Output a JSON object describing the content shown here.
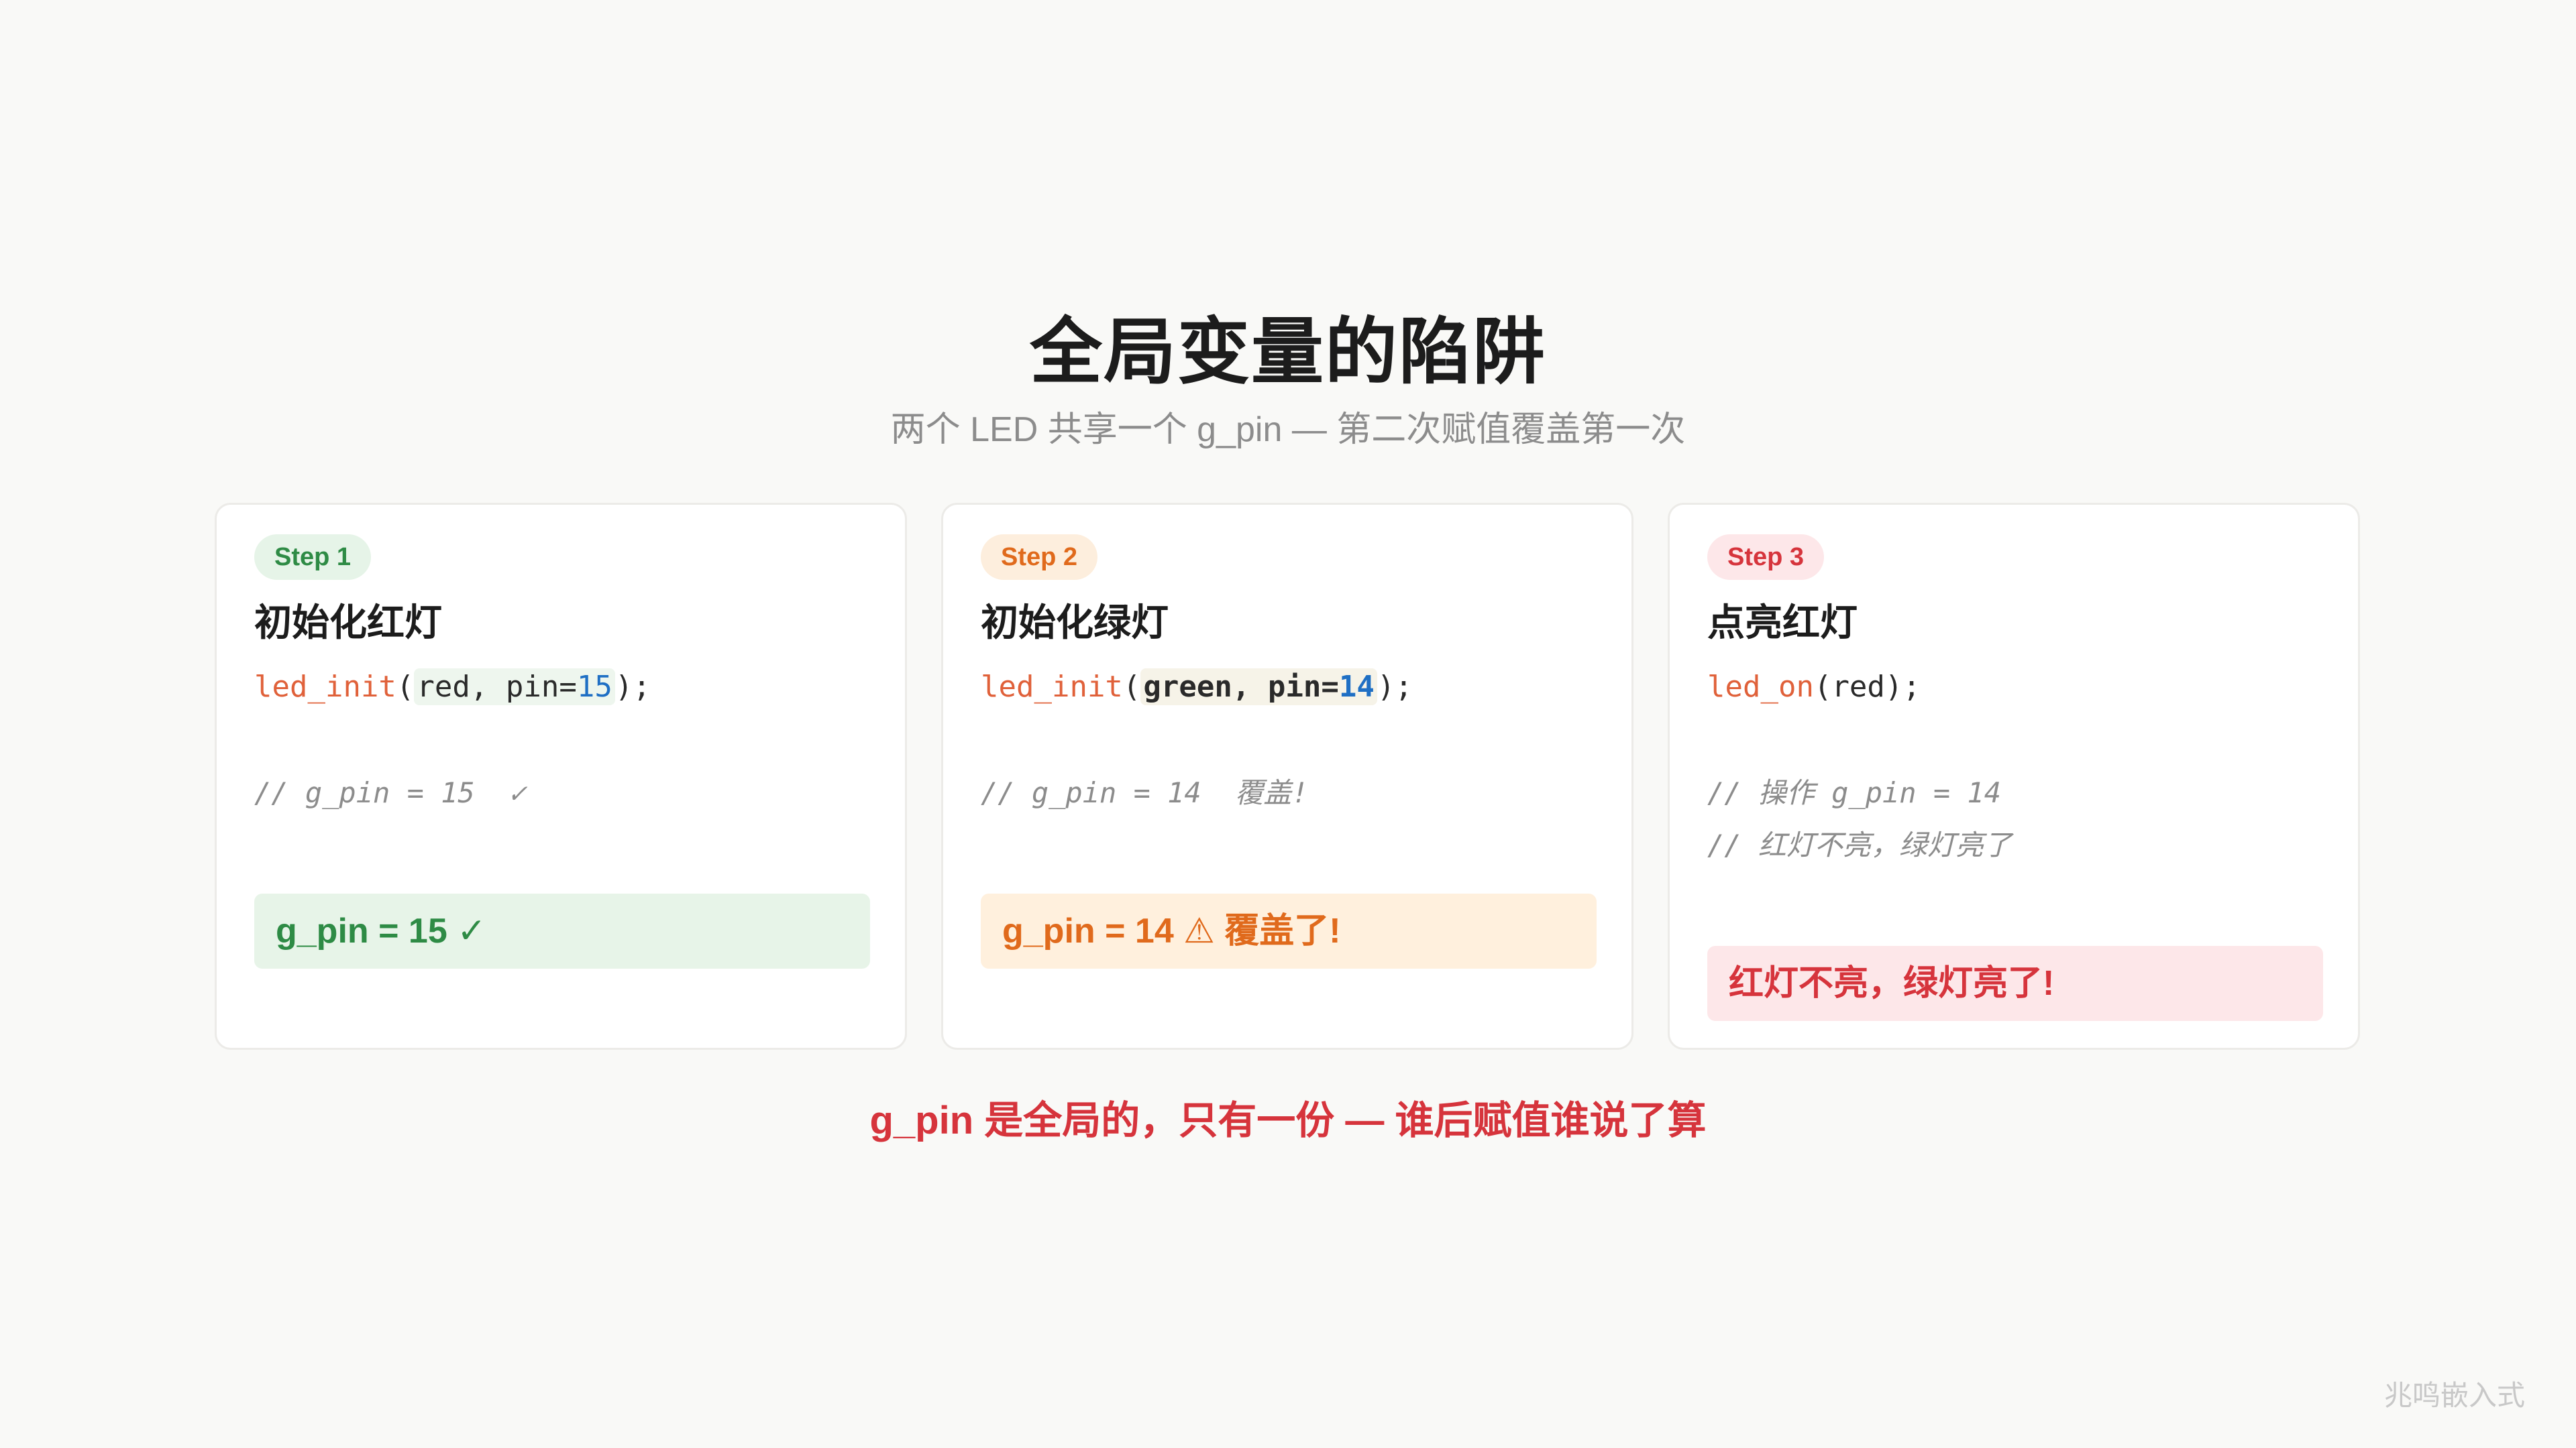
{
  "title": "全局变量的陷阱",
  "subtitle": "两个 LED 共享一个 g_pin — 第二次赋值覆盖第一次",
  "cards": [
    {
      "step_label": "Step 1",
      "title": "初始化红灯",
      "code": {
        "fn": "led_init",
        "open": "(",
        "arg1": "red, pin=",
        "arg_num": "15",
        "close": ");"
      },
      "comments": [
        "// g_pin = 15  ✓"
      ],
      "result": "g_pin = 15 ✓"
    },
    {
      "step_label": "Step 2",
      "title": "初始化绿灯",
      "code": {
        "fn": "led_init",
        "open": "(",
        "arg1": "green, pin=",
        "arg_num": "14",
        "close": ");"
      },
      "comments": [
        "// g_pin = 14  覆盖!"
      ],
      "result": "g_pin = 14 ⚠ 覆盖了!"
    },
    {
      "step_label": "Step 3",
      "title": "点亮红灯",
      "code": {
        "fn": "led_on",
        "rest": "(red);"
      },
      "comments": [
        "// 操作 g_pin = 14",
        "// 红灯不亮，绿灯亮了"
      ],
      "result": "红灯不亮，绿灯亮了!"
    }
  ],
  "takeaway": "g_pin 是全局的，只有一份 — 谁后赋值谁说了算",
  "watermark": "兆鸣嵌入式",
  "colors": {
    "green": "#2e8b45",
    "orange": "#e06a1c",
    "red": "#d6343c",
    "code_fn": "#e0613a",
    "code_num": "#1f6fc4"
  }
}
